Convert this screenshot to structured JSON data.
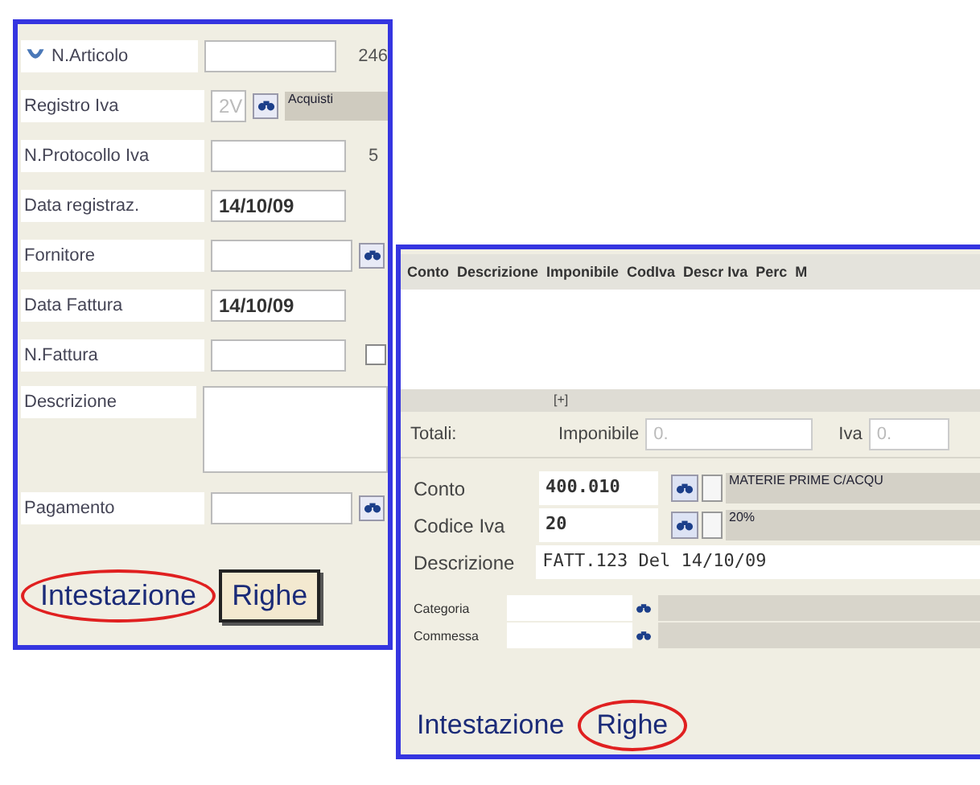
{
  "header_window": {
    "fields": [
      {
        "kind": "text",
        "label": "N.Articolo",
        "icon": true,
        "info": "246"
      },
      {
        "kind": "lookup",
        "label": "Registro Iva",
        "value": "2V",
        "disabled": true,
        "info": "Acquisti"
      },
      {
        "kind": "text",
        "label": "N.Protocollo Iva",
        "info": "5"
      },
      {
        "kind": "text",
        "label": "Data registraz.",
        "value": "14/10/09"
      },
      {
        "kind": "lookup",
        "label": "Fornitore"
      },
      {
        "kind": "text",
        "label": "Data Fattura",
        "value": "14/10/09"
      },
      {
        "kind": "check",
        "label": "N.Fattura",
        "checked": false
      },
      {
        "kind": "memo",
        "label": "Descrizione"
      },
      {
        "kind": "lookup",
        "label": "Pagamento"
      }
    ],
    "tabs": [
      {
        "label": "Intestazione",
        "selected": true
      },
      {
        "label": "Righe",
        "selected": false
      }
    ]
  },
  "lines_window": {
    "columns": [
      "Conto",
      "Descrizione",
      "Imponibile",
      "CodIva",
      "Descr Iva",
      "Perc",
      "M"
    ],
    "expander": "[+]",
    "totals": {
      "label": "Totali:",
      "items": [
        {
          "label": "Imponibile",
          "value": "0.",
          "disabled": true
        },
        {
          "label": "Iva",
          "value": "0.",
          "disabled": true
        }
      ]
    },
    "details": [
      {
        "kind": "lookup",
        "label": "Conto",
        "value": "400.010",
        "info": "MATERIE PRIME C/ACQU"
      },
      {
        "kind": "lookup",
        "label": "Codice Iva",
        "value": "20",
        "info": "20%"
      },
      {
        "kind": "text",
        "label": "Descrizione",
        "value": "FATT.123 Del 14/10/09"
      }
    ],
    "extra": [
      {
        "label": "Categoria"
      },
      {
        "label": "Commessa"
      }
    ],
    "tabs": [
      {
        "label": "Intestazione",
        "selected": false
      },
      {
        "label": "Righe",
        "selected": true
      }
    ]
  }
}
